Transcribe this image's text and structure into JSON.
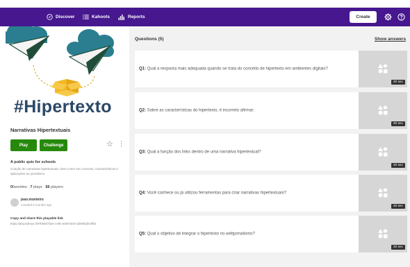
{
  "nav": {
    "discover": "Discover",
    "kahoots": "Kahoots",
    "reports": "Reports",
    "create": "Create"
  },
  "quiz": {
    "cover_hashtag": "#Hipertexto",
    "title": "Narrativas Hipertextuais",
    "play_label": "Play",
    "challenge_label": "Challenge",
    "visibility": "A public quiz for schools",
    "description": "Criação de narrativas hipertextuais, bem como seu conceito, características e aplicações ao jornalismo.",
    "favorites_count": "0",
    "favorites_label": "favorites",
    "plays_count": "7",
    "plays_label": "plays",
    "players_count": "66",
    "players_label": "players",
    "author": "jean.monteiro",
    "created": "Created 5 months ago",
    "share_label": "Copy and share this playable link",
    "share_link": "https://play.kahoot.it/#/k/5507b2e-cef5-4c85-be0e-d2668d3e4f9d"
  },
  "questions": {
    "header": "Questions (5)",
    "show_answers": "Show answers",
    "items": [
      {
        "num": "Q1:",
        "text": "Qual a resposta mais adequada quando se trata do conceito de hipertexto em ambientes digitais?",
        "time": "20 sec"
      },
      {
        "num": "Q2:",
        "text": "Sobre as características do hipertexto, é incorreto afirmar:",
        "time": "20 sec"
      },
      {
        "num": "Q3:",
        "text": "Qual a função dos links dentro de uma narrativa hipertextual?",
        "time": "20 sec"
      },
      {
        "num": "Q4:",
        "text": "Você conhece ou já utilizou ferramentas para criar narrativas hipertextuais?",
        "time": "20 sec"
      },
      {
        "num": "Q5:",
        "text": "Qual o objetivo de integrar o hipertexto no webjornalismo?",
        "time": "20 sec"
      }
    ]
  },
  "colors": {
    "topbar": "#46178f",
    "green": "#26890c",
    "hashtag": "#2b4866",
    "cloud": "#2a7e8f",
    "plane": "#1f4d39",
    "box": "#f2b824"
  },
  "icons": {
    "discover": "compass-icon",
    "kahoots": "list-icon",
    "reports": "bar-chart-icon",
    "settings": "gear-icon",
    "help": "help-icon",
    "favorite": "star-icon",
    "more": "more-icon"
  }
}
